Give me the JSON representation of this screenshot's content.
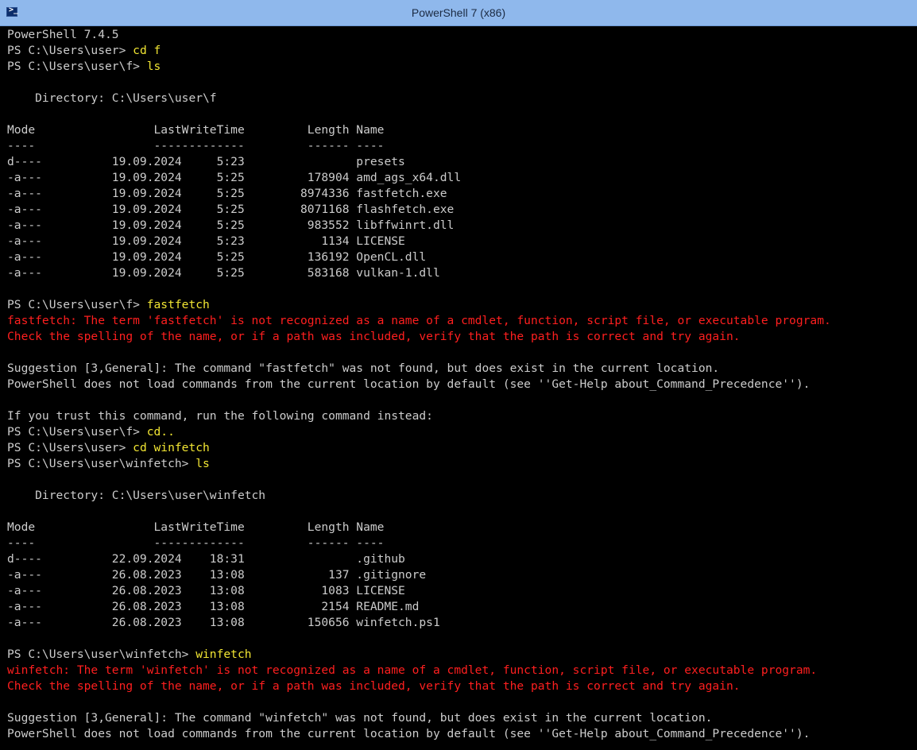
{
  "window": {
    "title": "PowerShell 7 (x86)",
    "icon": "powershell-icon"
  },
  "colors": {
    "titlebar": "#8fb8ec",
    "background": "#000000",
    "text": "#cccccc",
    "command": "#f2e633",
    "error": "#ff1f1f"
  },
  "console": {
    "lines": [
      {
        "type": "text",
        "text": "PowerShell 7.4.5"
      },
      {
        "type": "prompt",
        "prompt": "PS C:\\Users\\user> ",
        "command": "cd f"
      },
      {
        "type": "prompt",
        "prompt": "PS C:\\Users\\user\\f> ",
        "command": "ls"
      },
      {
        "type": "text",
        "text": ""
      },
      {
        "type": "text",
        "text": "    Directory: C:\\Users\\user\\f"
      },
      {
        "type": "text",
        "text": ""
      },
      {
        "type": "text",
        "text": "Mode                 LastWriteTime         Length Name"
      },
      {
        "type": "text",
        "text": "----                 -------------         ------ ----"
      },
      {
        "type": "text",
        "text": "d----          19.09.2024     5:23                presets"
      },
      {
        "type": "text",
        "text": "-a---          19.09.2024     5:25         178904 amd_ags_x64.dll"
      },
      {
        "type": "text",
        "text": "-a---          19.09.2024     5:25        8974336 fastfetch.exe"
      },
      {
        "type": "text",
        "text": "-a---          19.09.2024     5:25        8071168 flashfetch.exe"
      },
      {
        "type": "text",
        "text": "-a---          19.09.2024     5:25         983552 libffwinrt.dll"
      },
      {
        "type": "text",
        "text": "-a---          19.09.2024     5:23           1134 LICENSE"
      },
      {
        "type": "text",
        "text": "-a---          19.09.2024     5:25         136192 OpenCL.dll"
      },
      {
        "type": "text",
        "text": "-a---          19.09.2024     5:25         583168 vulkan-1.dll"
      },
      {
        "type": "text",
        "text": ""
      },
      {
        "type": "prompt",
        "prompt": "PS C:\\Users\\user\\f> ",
        "command": "fastfetch"
      },
      {
        "type": "error",
        "text": "fastfetch: The term 'fastfetch' is not recognized as a name of a cmdlet, function, script file, or executable program."
      },
      {
        "type": "error",
        "text": "Check the spelling of the name, or if a path was included, verify that the path is correct and try again."
      },
      {
        "type": "text",
        "text": ""
      },
      {
        "type": "text",
        "text": "Suggestion [3,General]: The command \"fastfetch\" was not found, but does exist in the current location."
      },
      {
        "type": "text",
        "text": "PowerShell does not load commands from the current location by default (see ''Get-Help about_Command_Precedence'')."
      },
      {
        "type": "text",
        "text": ""
      },
      {
        "type": "text",
        "text": "If you trust this command, run the following command instead:"
      },
      {
        "type": "prompt",
        "prompt": "PS C:\\Users\\user\\f> ",
        "command": "cd.."
      },
      {
        "type": "prompt",
        "prompt": "PS C:\\Users\\user> ",
        "command": "cd winfetch"
      },
      {
        "type": "prompt",
        "prompt": "PS C:\\Users\\user\\winfetch> ",
        "command": "ls"
      },
      {
        "type": "text",
        "text": ""
      },
      {
        "type": "text",
        "text": "    Directory: C:\\Users\\user\\winfetch"
      },
      {
        "type": "text",
        "text": ""
      },
      {
        "type": "text",
        "text": "Mode                 LastWriteTime         Length Name"
      },
      {
        "type": "text",
        "text": "----                 -------------         ------ ----"
      },
      {
        "type": "text",
        "text": "d----          22.09.2024    18:31                .github"
      },
      {
        "type": "text",
        "text": "-a---          26.08.2023    13:08            137 .gitignore"
      },
      {
        "type": "text",
        "text": "-a---          26.08.2023    13:08           1083 LICENSE"
      },
      {
        "type": "text",
        "text": "-a---          26.08.2023    13:08           2154 README.md"
      },
      {
        "type": "text",
        "text": "-a---          26.08.2023    13:08         150656 winfetch.ps1"
      },
      {
        "type": "text",
        "text": ""
      },
      {
        "type": "prompt",
        "prompt": "PS C:\\Users\\user\\winfetch> ",
        "command": "winfetch"
      },
      {
        "type": "error",
        "text": "winfetch: The term 'winfetch' is not recognized as a name of a cmdlet, function, script file, or executable program."
      },
      {
        "type": "error",
        "text": "Check the spelling of the name, or if a path was included, verify that the path is correct and try again."
      },
      {
        "type": "text",
        "text": ""
      },
      {
        "type": "text",
        "text": "Suggestion [3,General]: The command \"winfetch\" was not found, but does exist in the current location."
      },
      {
        "type": "text",
        "text": "PowerShell does not load commands from the current location by default (see ''Get-Help about_Command_Precedence'')."
      }
    ]
  }
}
